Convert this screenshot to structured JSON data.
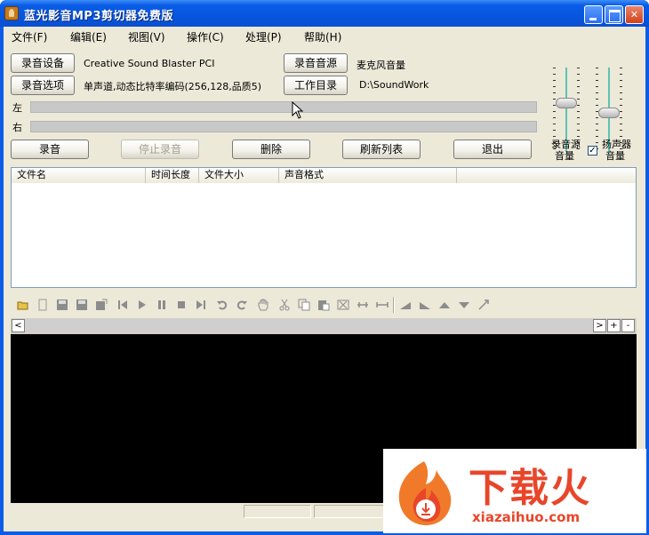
{
  "window": {
    "title": "蓝光影音MP3剪切器免费版"
  },
  "menu": [
    {
      "label": "文件(F)"
    },
    {
      "label": "编辑(E)"
    },
    {
      "label": "视图(V)"
    },
    {
      "label": "操作(C)"
    },
    {
      "label": "处理(P)"
    },
    {
      "label": "帮助(H)"
    }
  ],
  "settings": {
    "device_button": "录音设备",
    "device_value": "Creative Sound Blaster PCI",
    "options_button": "录音选项",
    "options_value": "单声道,动态比特率编码(256,128,品质5)",
    "source_button": "录音音源",
    "source_value": "麦克风音量",
    "workdir_button": "工作目录",
    "workdir_value": "D:\\SoundWork"
  },
  "meters": {
    "left_label": "左",
    "right_label": "右"
  },
  "actions": {
    "record": "录音",
    "stop": "停止录音",
    "delete": "删除",
    "refresh": "刷新列表",
    "exit": "退出"
  },
  "sliders": {
    "source_caption_1": "录音源",
    "source_caption_2": "音量",
    "speaker_caption_1": "扬声器",
    "speaker_caption_2": "音量",
    "speaker_checked": true,
    "check_mark": "✓"
  },
  "file_list": {
    "columns": [
      "文件名",
      "时间长度",
      "文件大小",
      "声音格式"
    ],
    "rows": []
  },
  "scroll": {
    "left": "<",
    "right": ">",
    "plus": "+",
    "minus": "-"
  },
  "watermark": {
    "text": "下载火",
    "url": "xiazaihuo.com"
  },
  "colors": {
    "titlebar": "#0654dc",
    "waveform_bg": "#000000",
    "watermark": "#e8462a",
    "slider_track": "#5ec2b4"
  }
}
